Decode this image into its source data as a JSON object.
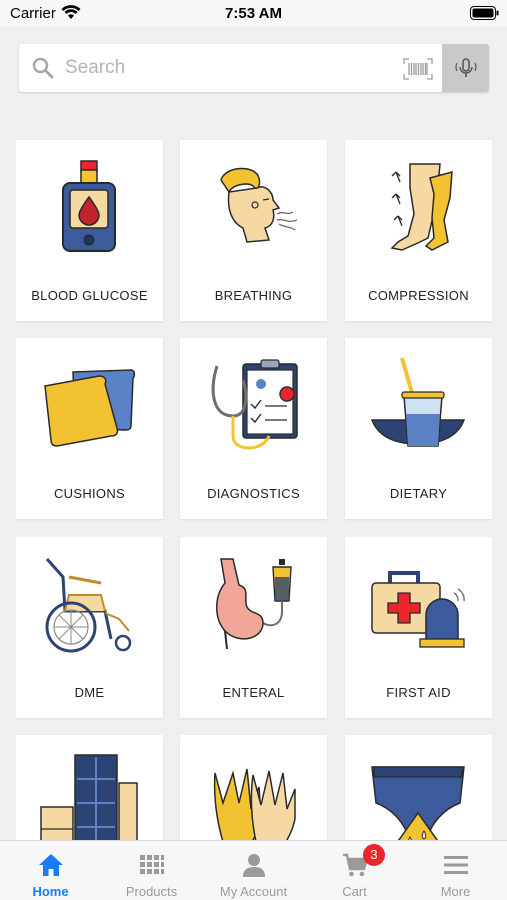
{
  "status_bar": {
    "carrier": "Carrier",
    "time": "7:53 AM"
  },
  "search": {
    "placeholder": "Search"
  },
  "categories": [
    {
      "label": "BLOOD GLUCOSE",
      "icon": "blood-glucose-meter-icon"
    },
    {
      "label": "BREATHING",
      "icon": "breathing-head-icon"
    },
    {
      "label": "COMPRESSION",
      "icon": "compression-legs-icon"
    },
    {
      "label": "CUSHIONS",
      "icon": "cushions-icon"
    },
    {
      "label": "DIAGNOSTICS",
      "icon": "stethoscope-clipboard-icon"
    },
    {
      "label": "DIETARY",
      "icon": "drink-glass-icon"
    },
    {
      "label": "DME",
      "icon": "wheelchair-icon"
    },
    {
      "label": "ENTERAL",
      "icon": "stomach-feeding-bag-icon"
    },
    {
      "label": "FIRST AID",
      "icon": "first-aid-kit-icon"
    },
    {
      "label": "",
      "icon": "storage-cabinet-icon"
    },
    {
      "label": "",
      "icon": "gloves-icon"
    },
    {
      "label": "",
      "icon": "incontinence-brief-icon"
    }
  ],
  "tabs": [
    {
      "label": "Home",
      "icon": "home-icon",
      "active": true
    },
    {
      "label": "Products",
      "icon": "grid-icon",
      "active": false
    },
    {
      "label": "My Account",
      "icon": "person-icon",
      "active": false
    },
    {
      "label": "Cart",
      "icon": "cart-icon",
      "active": false
    },
    {
      "label": "More",
      "icon": "menu-icon",
      "active": false
    }
  ],
  "cart_badge": "3",
  "colors": {
    "accent": "#1a7cf5",
    "badge": "#e8262c",
    "navy": "#2d4373",
    "yellow": "#f4c430"
  }
}
